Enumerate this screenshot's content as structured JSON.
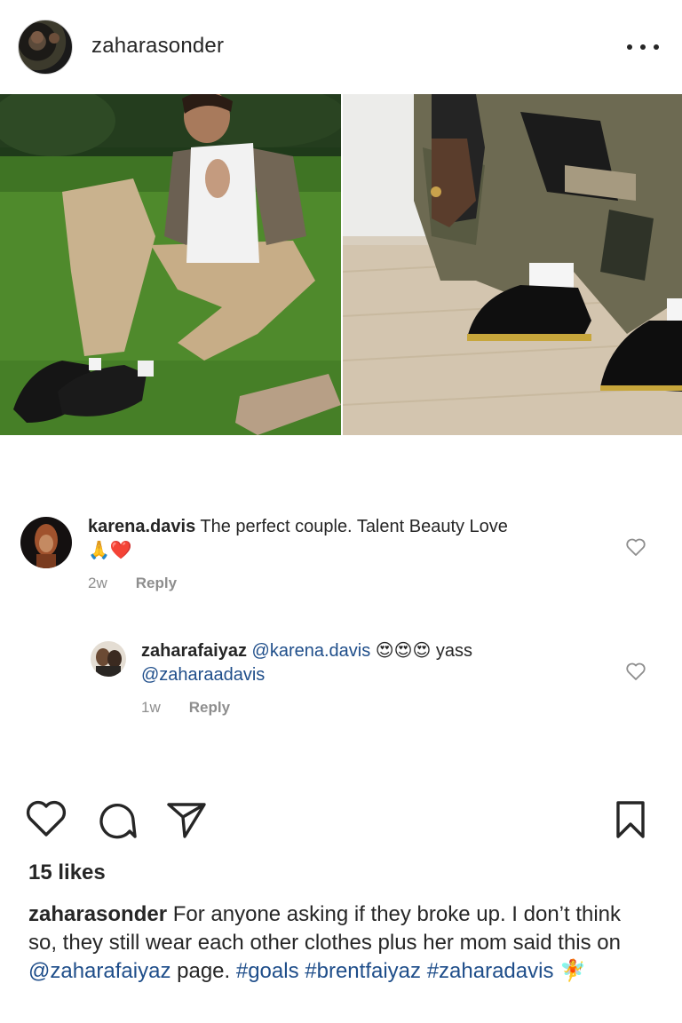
{
  "post": {
    "username": "zaharasonder",
    "more_icon": "more-horizontal-icon"
  },
  "comments": [
    {
      "username": "karena.davis",
      "text": "The perfect couple. Talent Beauty Love",
      "emoji": "🙏❤️",
      "time": "2w",
      "reply_label": "Reply"
    },
    {
      "username": "zaharafaiyaz",
      "mention1": "@karena.davis",
      "emoji": "😍😍😍",
      "text_after": "yass",
      "mention2": "@zaharaadavis",
      "time": "1w",
      "reply_label": "Reply"
    }
  ],
  "actions": {
    "like_icon": "heart-icon",
    "comment_icon": "comment-icon",
    "share_icon": "send-icon",
    "save_icon": "bookmark-icon"
  },
  "likes": "15 likes",
  "caption": {
    "username": "zaharasonder",
    "text1": "For anyone asking if they broke up. I don’t think so, they still wear each other clothes plus her mom said this on",
    "mention": "@zaharafaiyaz",
    "text2": "page.",
    "tag1": "#goals",
    "tag2": "#brentfaiyaz",
    "tag3": "#zaharadavis",
    "emoji": "🧚"
  },
  "colors": {
    "link": "#1f4e8a",
    "muted": "#8e8e8e",
    "text": "#262626"
  }
}
